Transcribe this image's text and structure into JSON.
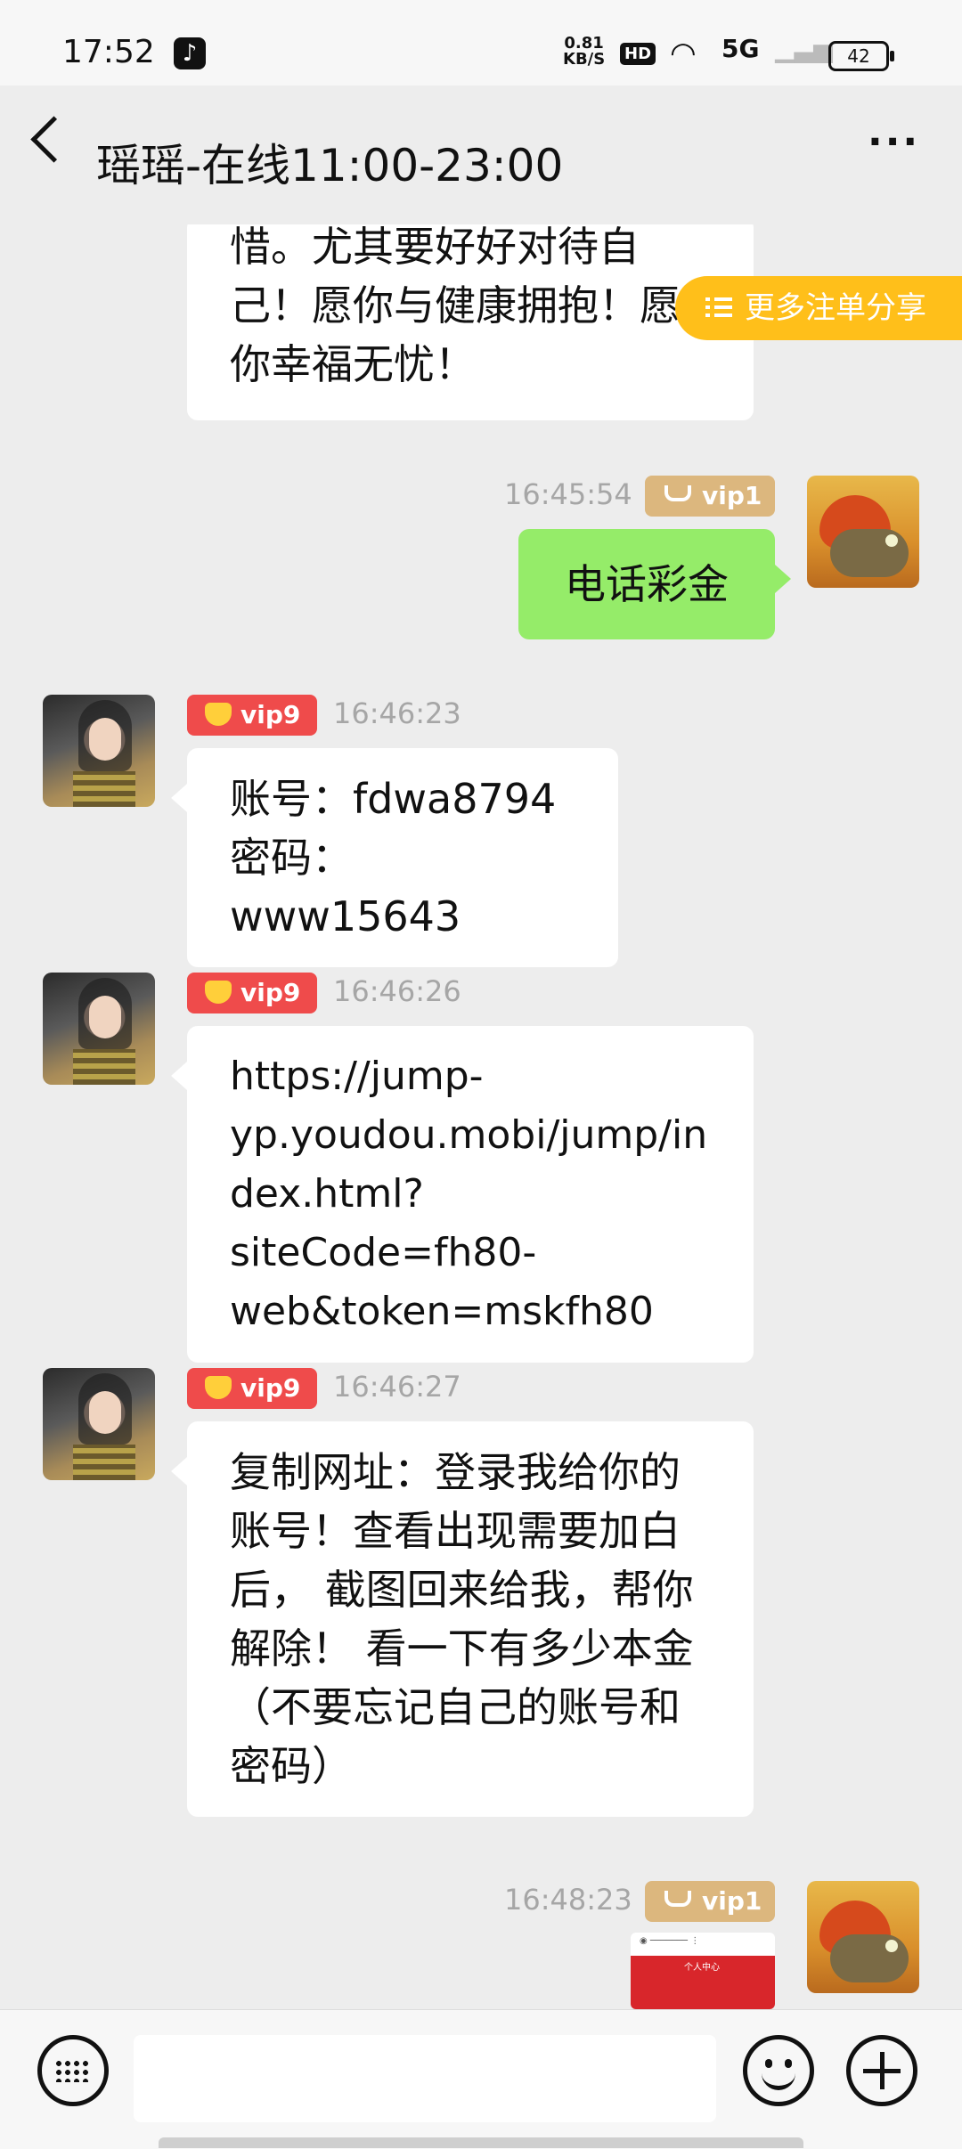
{
  "status_bar": {
    "time": "17:52",
    "app_icon": "tiktok-icon",
    "net_speed_value": "0.81",
    "net_speed_unit": "KB/S",
    "hd_label": "HD",
    "signal_label": "5G",
    "battery": "42"
  },
  "header": {
    "title": "瑶瑶-在线11:00-23:00",
    "back_icon": "chevron-left-icon",
    "more_label": "···"
  },
  "share_button": {
    "label": "更多注单分享",
    "icon": "list-icon"
  },
  "messages": [
    {
      "side": "left",
      "text_lines": [
        "惜。尤其要好好对待自",
        "己！愿你与健康拥抱！愿",
        "你幸福无忧！"
      ]
    },
    {
      "side": "right",
      "vip": "vip1",
      "time": "16:45:54",
      "text": "电话彩金"
    },
    {
      "side": "left",
      "vip": "vip9",
      "time": "16:46:23",
      "text_lines": [
        "账号：fdwa8794",
        "密码：www15643"
      ]
    },
    {
      "side": "left",
      "vip": "vip9",
      "time": "16:46:26",
      "text_lines": [
        "https://jump-",
        "yp.youdou.mobi/jump/in",
        "dex.html?siteCode=fh80-",
        "web&token=mskfh80"
      ]
    },
    {
      "side": "left",
      "vip": "vip9",
      "time": "16:46:27",
      "text_lines": [
        "复制网址：登录我给你的",
        "账号！查看出现需要加白",
        "后， 截图回来给我，帮你",
        "解除！ 看一下有多少本金",
        "（不要忘记自己的账号和",
        "密码）"
      ]
    },
    {
      "side": "right",
      "vip": "vip1",
      "time": "16:48:23",
      "type": "image"
    }
  ],
  "thumbnail_text": "个人中心",
  "input_bar": {
    "keyboard_icon": "keyboard-icon",
    "emoji_icon": "emoji-icon",
    "plus_icon": "plus-icon",
    "input_value": ""
  },
  "colors": {
    "sent_bubble": "#95ec69",
    "vip9_badge": "#ef4b4b",
    "vip1_badge": "#dcb77e",
    "share_pill": "#ffbf1a"
  }
}
